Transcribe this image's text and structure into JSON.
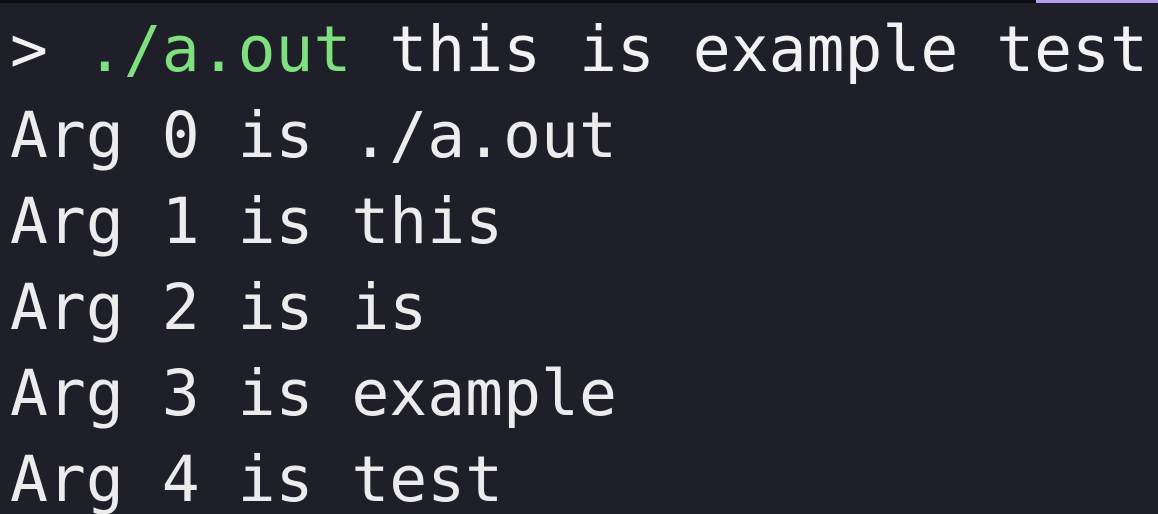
{
  "terminal": {
    "prompt_symbol": ">",
    "command": "./a.out",
    "arguments": "this is example test",
    "colors": {
      "background": "#1f1f29",
      "text": "#ececec",
      "command": "#7ee07f",
      "accent": "#b89cf0"
    },
    "output": [
      "Arg 0 is ./a.out",
      "Arg 1 is this",
      "Arg 2 is is",
      "Arg 3 is example",
      "Arg 4 is test"
    ]
  }
}
